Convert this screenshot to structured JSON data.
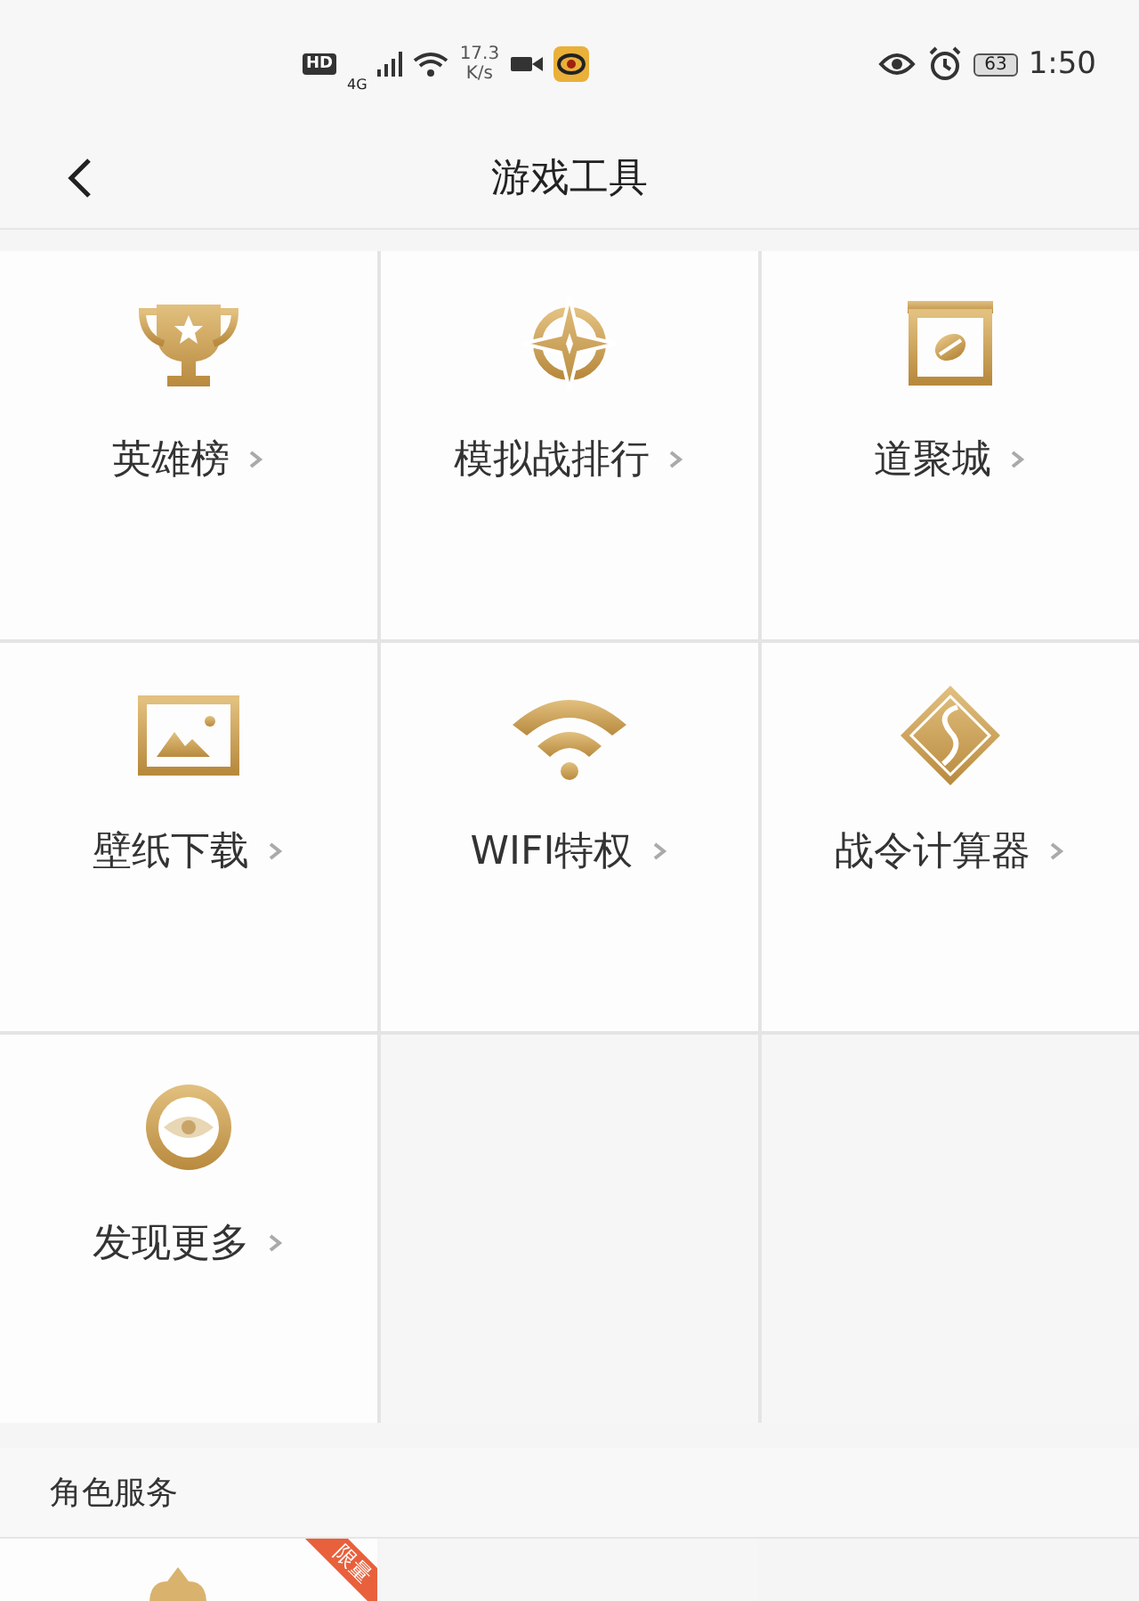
{
  "status_bar": {
    "network_badge": "HD",
    "network_type": "4G",
    "speed_value": "17.3",
    "speed_unit": "K/s",
    "battery": "63",
    "time": "1:50"
  },
  "header": {
    "title": "游戏工具"
  },
  "tools": [
    {
      "kind": "trophy",
      "label": "英雄榜"
    },
    {
      "kind": "compass",
      "label": "模拟战排行"
    },
    {
      "kind": "shop",
      "label": "道聚城"
    },
    {
      "kind": "image",
      "label": "壁纸下载"
    },
    {
      "kind": "wifi",
      "label": "WIFI特权"
    },
    {
      "kind": "diamond",
      "label": "战令计算器"
    },
    {
      "kind": "eye",
      "label": "发现更多"
    }
  ],
  "section": {
    "title": "角色服务",
    "items": [
      {
        "badge": "限量"
      }
    ]
  }
}
